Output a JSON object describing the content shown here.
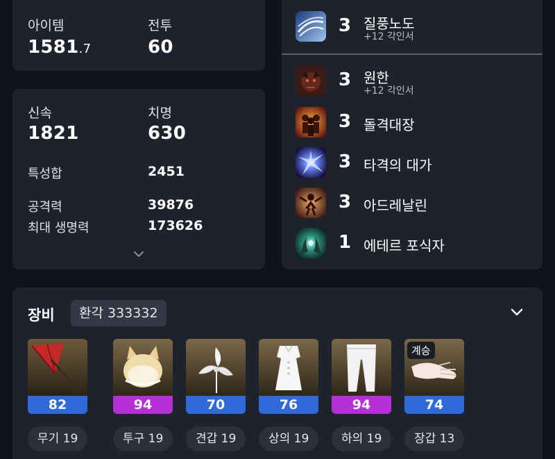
{
  "summary": {
    "item_label": "아이템",
    "item_level_main": "1581",
    "item_level_frac": ".7",
    "battle_label": "전투",
    "battle_level": "60"
  },
  "stats": {
    "swift_label": "신속",
    "swift_value": "1821",
    "crit_label": "치명",
    "crit_value": "630",
    "trait_sum_label": "특성합",
    "trait_sum_value": "2451",
    "attack_label": "공격력",
    "attack_value": "39876",
    "max_hp_label": "최대 생명력",
    "max_hp_value": "173626",
    "expand_icon": "chevron-down-icon"
  },
  "engravings": [
    {
      "level": "3",
      "name": "질풍노도",
      "sub": "+12 각인서",
      "icon": "gale-icon"
    },
    {
      "level": "3",
      "name": "원한",
      "sub": "+12 각인서",
      "icon": "grudge-icon"
    },
    {
      "level": "3",
      "name": "돌격대장",
      "sub": "",
      "icon": "raid-captain-icon"
    },
    {
      "level": "3",
      "name": "타격의 대가",
      "sub": "",
      "icon": "hit-master-icon"
    },
    {
      "level": "3",
      "name": "아드레날린",
      "sub": "",
      "icon": "adrenaline-icon"
    },
    {
      "level": "1",
      "name": "에테르 포식자",
      "sub": "",
      "icon": "ether-predator-icon"
    }
  ],
  "equipment": {
    "title": "장비",
    "elixir_badge": "환각 333332",
    "toggle_icon": "chevron-down-icon",
    "items": [
      {
        "quality": "82",
        "quality_color": "#2f6ad8",
        "label": "무기 19",
        "tag": "",
        "icon": "parasol-weapon-icon"
      },
      {
        "quality": "94",
        "quality_color": "#b42fd5",
        "label": "투구 19",
        "tag": "",
        "icon": "fox-hood-icon"
      },
      {
        "quality": "70",
        "quality_color": "#2f6ad8",
        "label": "견갑 19",
        "tag": "",
        "icon": "flower-shoulder-icon"
      },
      {
        "quality": "76",
        "quality_color": "#2f6ad8",
        "label": "상의 19",
        "tag": "",
        "icon": "white-dress-icon"
      },
      {
        "quality": "94",
        "quality_color": "#b42fd5",
        "label": "하의 19",
        "tag": "",
        "icon": "white-pants-icon"
      },
      {
        "quality": "74",
        "quality_color": "#2f6ad8",
        "label": "장갑 13",
        "tag": "계승",
        "icon": "glove-icon"
      }
    ]
  },
  "colors": {
    "background": "#10131a",
    "card": "#1e222c",
    "quality_blue": "#2f6ad8",
    "quality_purple": "#b42fd5"
  }
}
